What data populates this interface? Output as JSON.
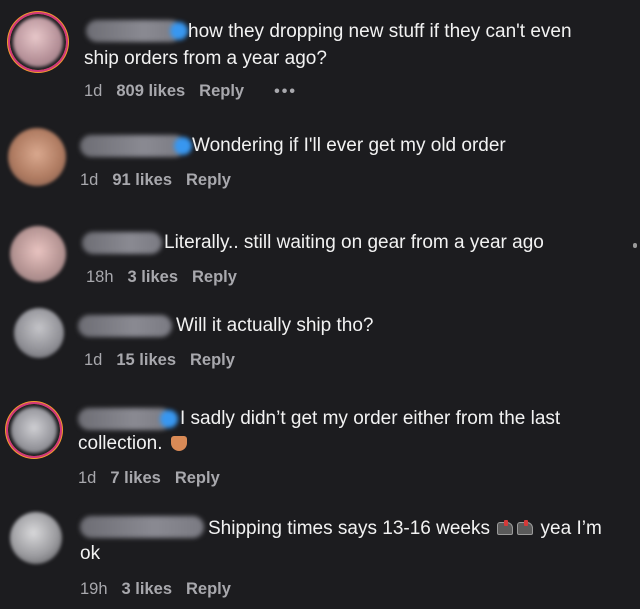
{
  "comments": [
    {
      "text_line1": "how they dropping new stuff if they can't even",
      "text_line2": "ship orders from a year ago?",
      "time": "1d",
      "likes": "809 likes",
      "reply": "Reply",
      "more": "•••"
    },
    {
      "text_line1": "Wondering if I'll ever get my old order",
      "time": "1d",
      "likes": "91 likes",
      "reply": "Reply"
    },
    {
      "text_line1": "Literally.. still waiting on gear from a year ago",
      "time": "18h",
      "likes": "3 likes",
      "reply": "Reply"
    },
    {
      "text_line1": "Will it actually ship tho?",
      "time": "1d",
      "likes": "15 likes",
      "reply": "Reply"
    },
    {
      "text_line1": "I sadly didn’t get my order either from the last",
      "text_line2": "collection.",
      "time": "1d",
      "likes": "7 likes",
      "reply": "Reply"
    },
    {
      "text_line1": "Shipping times says 13-16 weeks",
      "text_line1_end": "yea I’m",
      "text_line2": "ok",
      "time": "19h",
      "likes": "3 likes",
      "reply": "Reply"
    }
  ],
  "icons": {
    "thumbs_down": "thumbs-down-emoji",
    "shoe": "running-shoe-emoji",
    "verified": "verified-badge-icon"
  },
  "colors": {
    "background": "#1c1c1f",
    "text": "#f2f2f2",
    "meta": "#a8a8ad",
    "verified": "#3897f0"
  }
}
